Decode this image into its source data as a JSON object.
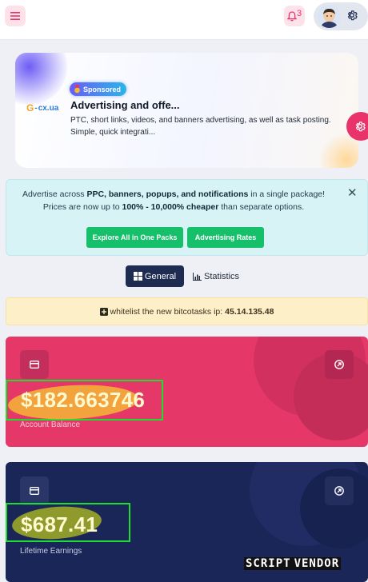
{
  "header": {
    "notification_count": "3"
  },
  "sponsored": {
    "badge_label": "Sponsored",
    "logo_text": "cx.ua",
    "title": "Advertising and offe...",
    "description_line1": "PTC, short links, videos, and banners advertising, as well as task posting.",
    "description_line2": "Simple, quick integrati..."
  },
  "promo": {
    "line1_pre": "Advertise across ",
    "line1_bold": "PPC, banners, popups, and notifications",
    "line1_post": " in a single package!",
    "line2_pre": "Prices are now up to ",
    "line2_bold": "100% - 10,000% cheaper",
    "line2_post": " than separate options.",
    "close_symbol": "✕",
    "button_packs": "Explore All in One Packs",
    "button_rates": "Advertising Rates"
  },
  "tabs": [
    {
      "label": "General",
      "active": true
    },
    {
      "label": "Statistics",
      "active": false
    }
  ],
  "whitelist": {
    "text": "whitelist the new bitcotasks ip:",
    "ip": "45.14.135.48"
  },
  "cards": {
    "balance": {
      "amount": "$182.663746",
      "label": "Account Balance"
    },
    "earnings": {
      "amount": "$687.41",
      "label": "Lifetime Earnings"
    }
  },
  "watermark": {
    "brand_part1": "SCRIPT",
    "brand_part2": "VENDOR"
  },
  "colors": {
    "accent_pink": "#e8336b",
    "balance_card": "#e53768",
    "earnings_card": "#1b2658",
    "green_button": "#16c06b",
    "highlight_box": "#1fdc33"
  }
}
